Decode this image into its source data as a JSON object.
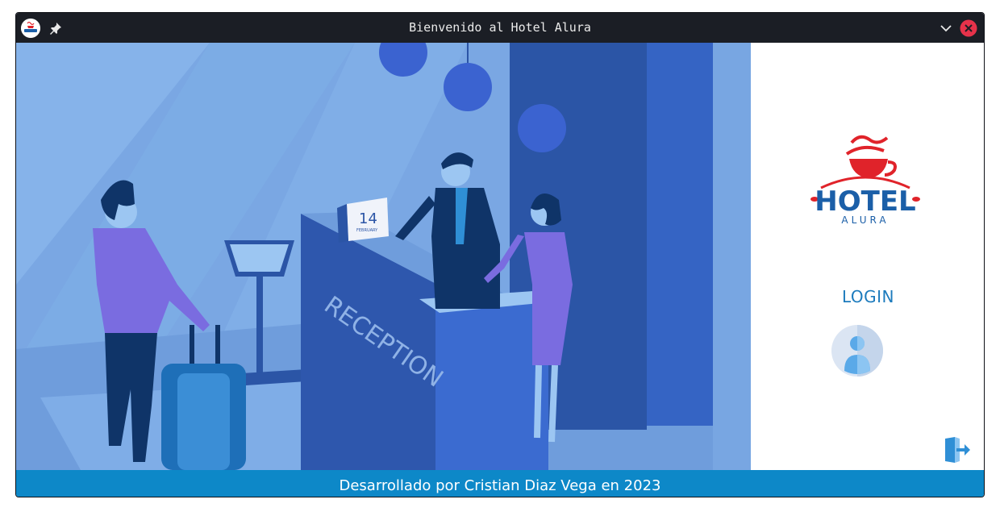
{
  "window": {
    "title": "Bienvenido al Hotel Alura"
  },
  "scene": {
    "calendar_day": "14",
    "calendar_month": "FEBRUARY",
    "desk_sign": "RECEPTION"
  },
  "sidebar": {
    "logo_main": "HOTEL",
    "logo_sub": "ALURA",
    "login_label": "LOGIN"
  },
  "footer": {
    "credit": "Desarrollado por Cristian Diaz Vega en 2023"
  },
  "colors": {
    "accent": "#1d7bbd",
    "footer_bg": "#0d88c8",
    "logo_red": "#e0232a",
    "logo_blue": "#1b5fa8",
    "scene_bg": "#7aa7e3",
    "titlebar_bg": "#1b1e25",
    "close_red": "#e6324a"
  },
  "icons": {
    "app": "hotel-logo-icon",
    "pin": "pin-icon",
    "minimize": "chevron-down-icon",
    "close": "close-icon",
    "user": "user-avatar-icon",
    "exit": "exit-door-icon"
  }
}
